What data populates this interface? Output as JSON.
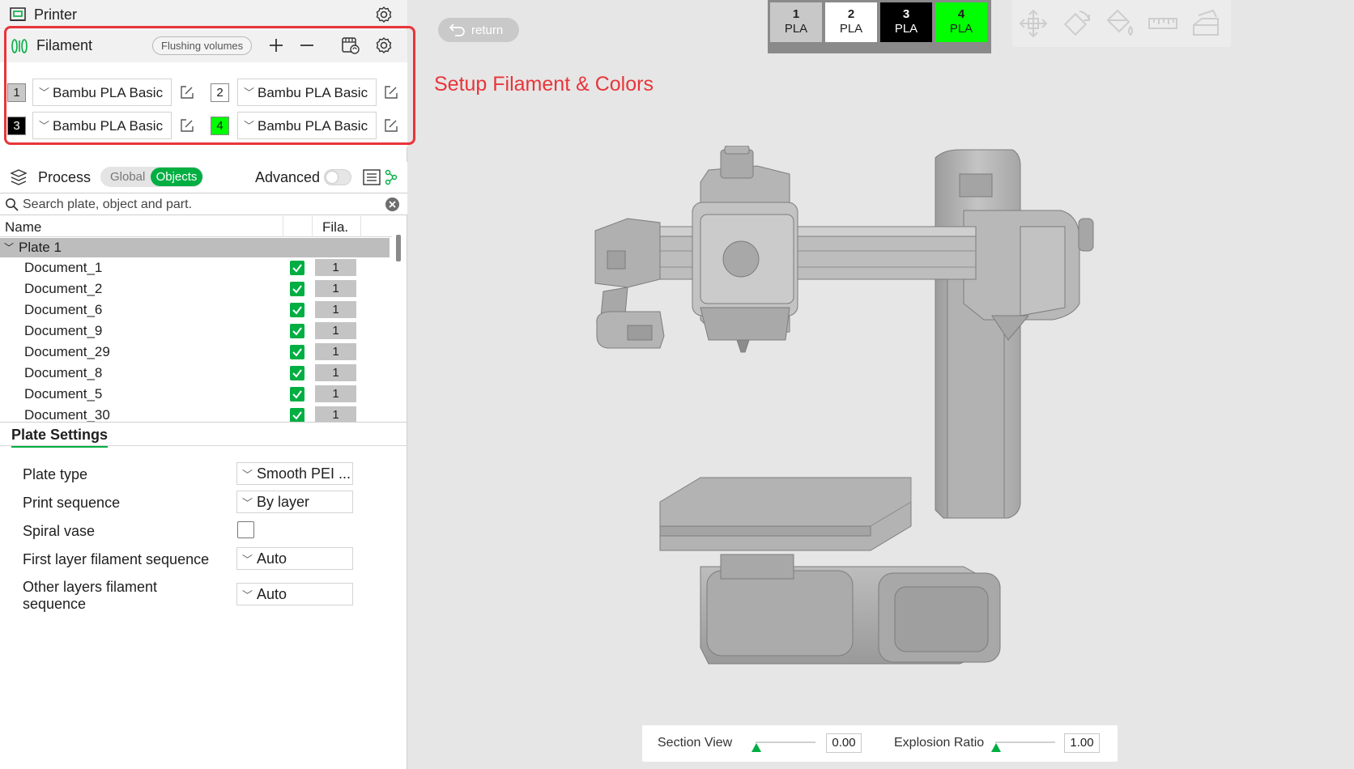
{
  "printer": {
    "label": "Printer"
  },
  "filament": {
    "label": "Filament",
    "flushing_label": "Flushing volumes",
    "slots": [
      {
        "num": "1",
        "name": "Bambu PLA Basic",
        "color": "#c8c8c8",
        "text_color": "#1f1f1f"
      },
      {
        "num": "2",
        "name": "Bambu PLA Basic",
        "color": "#ffffff",
        "text_color": "#1f1f1f"
      },
      {
        "num": "3",
        "name": "Bambu PLA Basic",
        "color": "#000000",
        "text_color": "#ffffff"
      },
      {
        "num": "4",
        "name": "Bambu PLA Basic",
        "color": "#00ff00",
        "text_color": "#1f1f1f"
      }
    ]
  },
  "annotation": {
    "text": "Setup Filament & Colors",
    "color": "#e8353a"
  },
  "process": {
    "label": "Process",
    "seg_global": "Global",
    "seg_objects": "Objects",
    "advanced_label": "Advanced"
  },
  "search": {
    "placeholder": "Search plate, object and part."
  },
  "table": {
    "col_name": "Name",
    "col_fila": "Fila.",
    "plate": "Plate 1",
    "objects": [
      {
        "name": "Document_1",
        "fila": "1"
      },
      {
        "name": "Document_2",
        "fila": "1"
      },
      {
        "name": "Document_6",
        "fila": "1"
      },
      {
        "name": "Document_9",
        "fila": "1"
      },
      {
        "name": "Document_29",
        "fila": "1"
      },
      {
        "name": "Document_8",
        "fila": "1"
      },
      {
        "name": "Document_5",
        "fila": "1"
      },
      {
        "name": "Document_30",
        "fila": "1"
      }
    ]
  },
  "plate_settings": {
    "tab": "Plate Settings",
    "plate_type": {
      "label": "Plate type",
      "value": "Smooth PEI ..."
    },
    "print_sequence": {
      "label": "Print sequence",
      "value": "By layer"
    },
    "spiral_vase": {
      "label": "Spiral vase"
    },
    "first_layer": {
      "label": "First layer filament sequence",
      "value": "Auto"
    },
    "other_layers": {
      "label": "Other layers filament sequence",
      "value": "Auto"
    }
  },
  "viewport": {
    "return_label": "return",
    "swatches": [
      {
        "num": "1",
        "type": "PLA",
        "color": "#c8c8c8",
        "text_color": "#1f1f1f"
      },
      {
        "num": "2",
        "type": "PLA",
        "color": "#ffffff",
        "text_color": "#1f1f1f"
      },
      {
        "num": "3",
        "type": "PLA",
        "color": "#000000",
        "text_color": "#ffffff"
      },
      {
        "num": "4",
        "type": "PLA",
        "color": "#00ff00",
        "text_color": "#1f1f1f"
      }
    ],
    "section_view": {
      "label": "Section View",
      "value": "0.00"
    },
    "explosion_ratio": {
      "label": "Explosion Ratio",
      "value": "1.00"
    }
  },
  "colors": {
    "accent": "#00ae42"
  }
}
